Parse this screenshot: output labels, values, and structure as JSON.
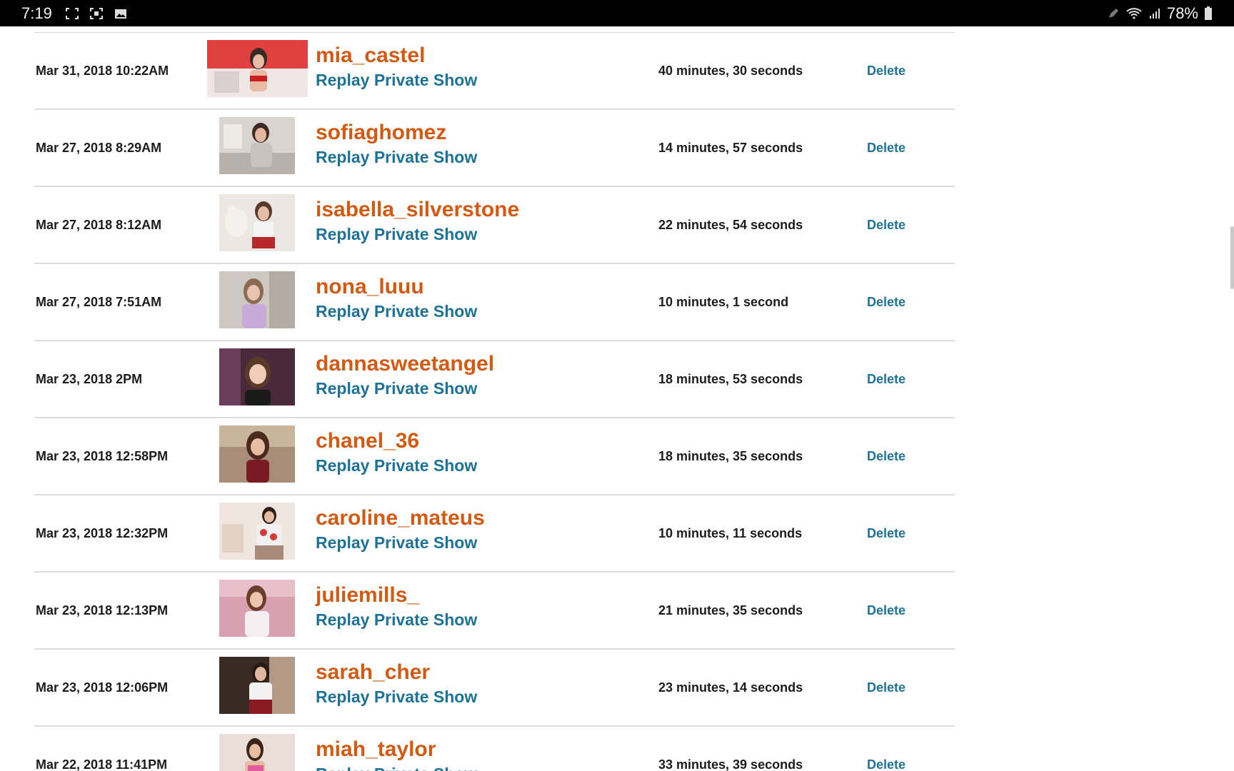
{
  "status_bar": {
    "time": "7:19",
    "battery_text": "78%",
    "icons": [
      "expand-icon",
      "screenshot-icon",
      "gallery-icon",
      "pen-icon",
      "wifi-icon",
      "signal-icon",
      "battery-icon"
    ]
  },
  "colors": {
    "model_name": "#d35a12",
    "link": "#1d7397",
    "text": "#1c1c1c",
    "divider": "#dcdcdc"
  },
  "rows": [
    {
      "date": "Mar 31, 2018 10:22AM",
      "model": "mia_castel",
      "replay": "Replay Private Show",
      "duration": "40 minutes, 30 seconds",
      "delete": "Delete"
    },
    {
      "date": "Mar 27, 2018 8:29AM",
      "model": "sofiaghomez",
      "replay": "Replay Private Show",
      "duration": "14 minutes, 57 seconds",
      "delete": "Delete"
    },
    {
      "date": "Mar 27, 2018 8:12AM",
      "model": "isabella_silverstone",
      "replay": "Replay Private Show",
      "duration": "22 minutes, 54 seconds",
      "delete": "Delete"
    },
    {
      "date": "Mar 27, 2018 7:51AM",
      "model": "nona_luuu",
      "replay": "Replay Private Show",
      "duration": "10 minutes, 1 second",
      "delete": "Delete"
    },
    {
      "date": "Mar 23, 2018 2PM",
      "model": "dannasweetangel",
      "replay": "Replay Private Show",
      "duration": "18 minutes, 53 seconds",
      "delete": "Delete"
    },
    {
      "date": "Mar 23, 2018 12:58PM",
      "model": "chanel_36",
      "replay": "Replay Private Show",
      "duration": "18 minutes, 35 seconds",
      "delete": "Delete"
    },
    {
      "date": "Mar 23, 2018 12:32PM",
      "model": "caroline_mateus",
      "replay": "Replay Private Show",
      "duration": "10 minutes, 11 seconds",
      "delete": "Delete"
    },
    {
      "date": "Mar 23, 2018 12:13PM",
      "model": "juliemills_",
      "replay": "Replay Private Show",
      "duration": "21 minutes, 35 seconds",
      "delete": "Delete"
    },
    {
      "date": "Mar 23, 2018 12:06PM",
      "model": "sarah_cher",
      "replay": "Replay Private Show",
      "duration": "23 minutes, 14 seconds",
      "delete": "Delete"
    },
    {
      "date": "Mar 22, 2018 11:41PM",
      "model": "miah_taylor",
      "replay": "Replay Private Show",
      "duration": "33 minutes, 39 seconds",
      "delete": "Delete"
    }
  ]
}
